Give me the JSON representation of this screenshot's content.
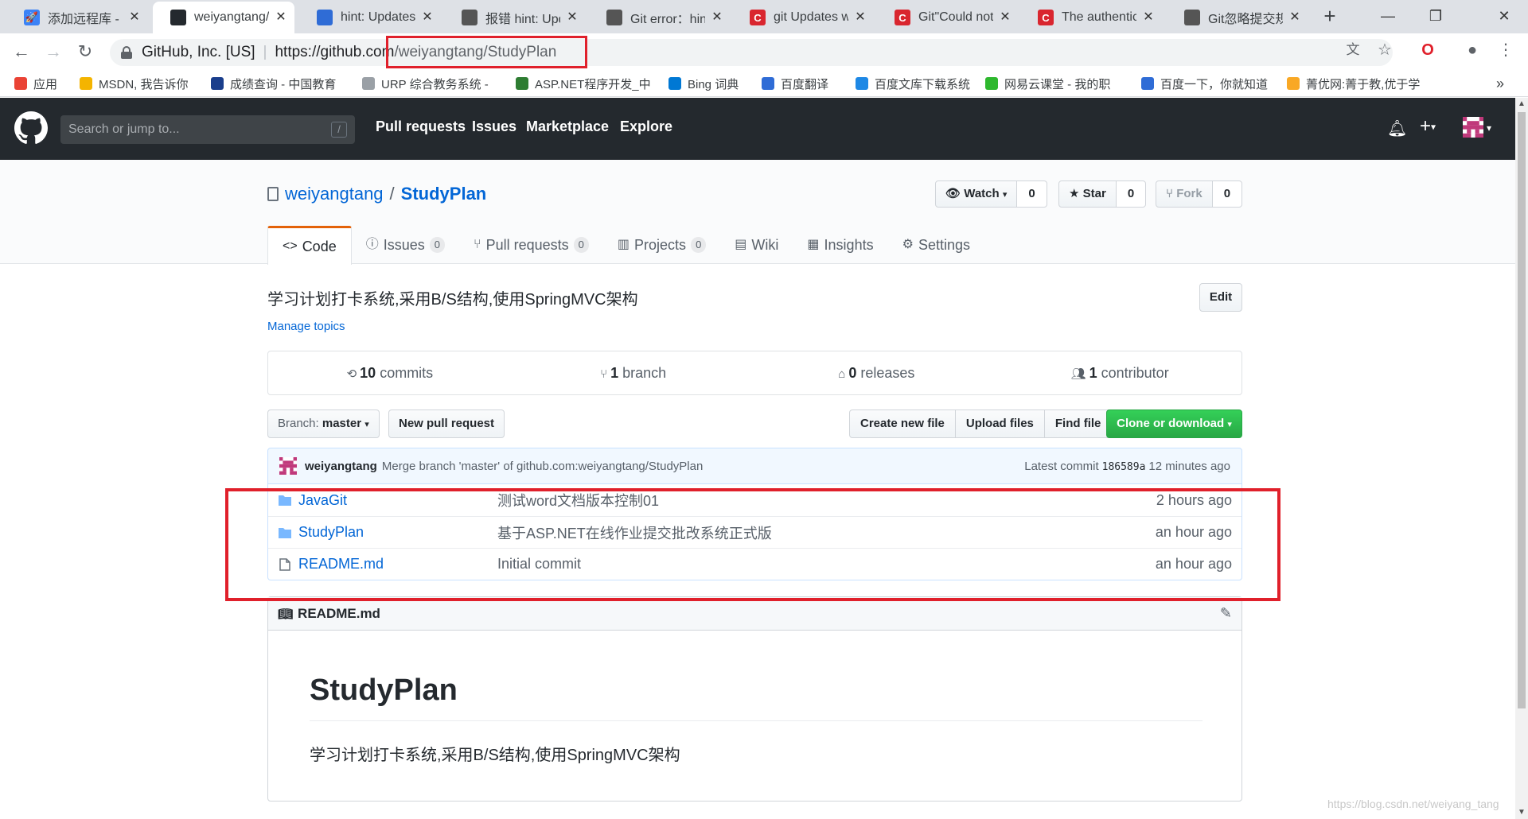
{
  "browser": {
    "tabs": [
      {
        "title": "添加远程库 - 廖",
        "favicon_color": "#3b82f6",
        "favicon_glyph": "🚀",
        "active": false
      },
      {
        "title": "weiyangtang/",
        "favicon_color": "#24292e",
        "favicon_glyph": "",
        "active": true
      },
      {
        "title": "hint: Updates",
        "favicon_color": "#2f6cd6",
        "favicon_glyph": "",
        "active": false
      },
      {
        "title": "报错 hint: Upd",
        "favicon_color": "#555555",
        "favicon_glyph": "",
        "active": false
      },
      {
        "title": "Git error：hin",
        "favicon_color": "#555555",
        "favicon_glyph": "",
        "active": false
      },
      {
        "title": "git Updates w",
        "favicon_color": "#d9262f",
        "favicon_glyph": "C",
        "active": false
      },
      {
        "title": "Git\"Could not",
        "favicon_color": "#d9262f",
        "favicon_glyph": "C",
        "active": false
      },
      {
        "title": "The authentic",
        "favicon_color": "#d9262f",
        "favicon_glyph": "C",
        "active": false
      },
      {
        "title": "Git忽略提交规",
        "favicon_color": "#555555",
        "favicon_glyph": "",
        "active": false
      }
    ],
    "omnibox": {
      "site": "GitHub, Inc. [US]",
      "url_host": "https://github.com",
      "url_path": "/weiyangtang/StudyPlan"
    },
    "bookmarks": [
      {
        "label": "应用",
        "color": "#ea4335"
      },
      {
        "label": "MSDN, 我告诉你",
        "color": "#f4b400"
      },
      {
        "label": "成绩查询 - 中国教育",
        "color": "#1a3e8c"
      },
      {
        "label": "URP 综合教务系统 -",
        "color": "#9aa0a6"
      },
      {
        "label": "ASP.NET程序开发_中",
        "color": "#2e7d32"
      },
      {
        "label": "Bing 词典",
        "color": "#0078d4"
      },
      {
        "label": "百度翻译",
        "color": "#2f6cd6"
      },
      {
        "label": "百度文库下载系统",
        "color": "#1e88e5"
      },
      {
        "label": "网易云课堂 - 我的职",
        "color": "#2eb82e"
      },
      {
        "label": "百度一下，你就知道",
        "color": "#2f6cd6"
      },
      {
        "label": "菁优网:菁于教,优于学",
        "color": "#f9a825"
      }
    ]
  },
  "github": {
    "search_placeholder": "Search or jump to...",
    "search_key": "/",
    "nav": [
      "Pull requests",
      "Issues",
      "Marketplace",
      "Explore"
    ],
    "repo": {
      "owner": "weiyangtang",
      "separator": "/",
      "name": "StudyPlan",
      "watch": {
        "label": "Watch",
        "count": "0"
      },
      "star": {
        "label": "Star",
        "count": "0"
      },
      "fork": {
        "label": "Fork",
        "count": "0"
      }
    },
    "tabs": [
      {
        "label": "Code",
        "icon": "<>",
        "counter": "",
        "selected": true
      },
      {
        "label": "Issues",
        "icon": "ⓘ",
        "counter": "0",
        "selected": false
      },
      {
        "label": "Pull requests",
        "icon": "⑂",
        "counter": "0",
        "selected": false
      },
      {
        "label": "Projects",
        "icon": "▥",
        "counter": "0",
        "selected": false
      },
      {
        "label": "Wiki",
        "icon": "▤",
        "counter": "",
        "selected": false
      },
      {
        "label": "Insights",
        "icon": "▦",
        "counter": "",
        "selected": false
      },
      {
        "label": "Settings",
        "icon": "⚙",
        "counter": "",
        "selected": false
      }
    ],
    "description": "学习计划打卡系统,采用B/S结构,使用SpringMVC架构",
    "edit_label": "Edit",
    "manage_topics": "Manage topics",
    "summary": {
      "commits_num": "10",
      "commits_label": "commits",
      "branch_num": "1",
      "branch_label": "branch",
      "releases_num": "0",
      "releases_label": "releases",
      "contributor_num": "1",
      "contributor_label": "contributor"
    },
    "branch": {
      "label": "Branch:",
      "value": "master"
    },
    "new_pr": "New pull request",
    "file_buttons": [
      "Create new file",
      "Upload files",
      "Find file"
    ],
    "clone": "Clone or download",
    "latest_commit": {
      "author": "weiyangtang",
      "message": "Merge branch 'master' of github.com:weiyangtang/StudyPlan",
      "prefix": "Latest commit",
      "sha": "186589a",
      "age": "12 minutes ago"
    },
    "files": [
      {
        "type": "folder",
        "name": "JavaGit",
        "message": "测试word文档版本控制01",
        "age": "2 hours ago"
      },
      {
        "type": "folder",
        "name": "StudyPlan",
        "message": "基于ASP.NET在线作业提交批改系统正式版",
        "age": "an hour ago"
      },
      {
        "type": "file",
        "name": "README.md",
        "message": "Initial commit",
        "age": "an hour ago"
      }
    ],
    "readme": {
      "filename": "README.md",
      "heading": "StudyPlan",
      "body": "学习计划打卡系统,采用B/S结构,使用SpringMVC架构"
    }
  },
  "watermark": "https://blog.csdn.net/weiyang_tang",
  "colors": {
    "accent_red": "#e0202b",
    "github_dark": "#24292e",
    "link": "#0366d6",
    "green": "#28a745"
  }
}
